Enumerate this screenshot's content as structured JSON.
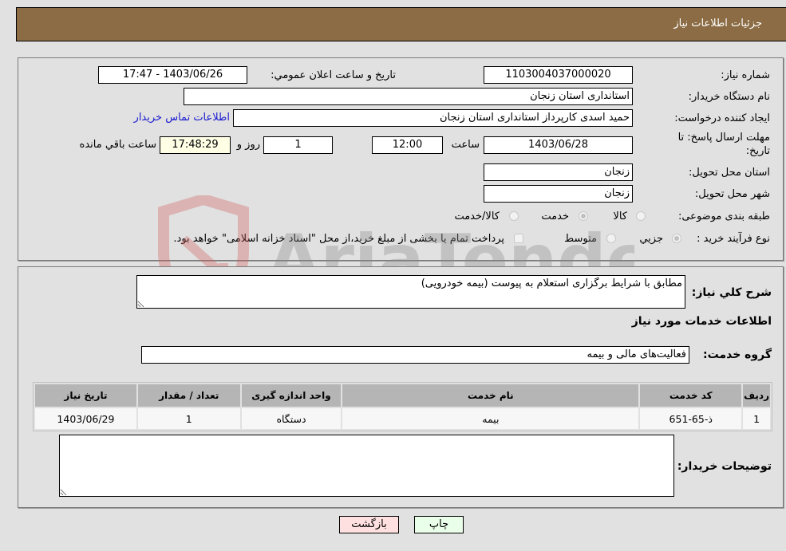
{
  "header": {
    "title": "جزئیات اطلاعات نیاز"
  },
  "details": {
    "need_number": {
      "label": "شماره نیاز:",
      "value": "1103004037000020"
    },
    "announce_datetime": {
      "label": "تاریخ و ساعت اعلان عمومي:",
      "value": "1403/06/26 - 17:47"
    },
    "buyer_org": {
      "label": "نام دستگاه خريدار:",
      "value": "استانداری استان زنجان"
    },
    "requester": {
      "label": "ايجاد کننده درخواست:",
      "value": "حمید اسدی کارپرداز استانداری استان زنجان"
    },
    "buyer_contact_link": "اطلاعات تماس خريدار",
    "deadline": {
      "label_line1": "مهلت ارسال پاسخ: تا",
      "label_line2": "تاریخ:",
      "date": "1403/06/28",
      "time_label": "ساعت",
      "time": "12:00",
      "days": "1",
      "days_label": "روز و",
      "remaining_time": "17:48:29",
      "remaining_label": "ساعت باقي مانده"
    },
    "delivery_province": {
      "label": "استان محل تحويل:",
      "value": "زنجان"
    },
    "delivery_city": {
      "label": "شهر محل تحويل:",
      "value": "زنجان"
    },
    "category": {
      "label": "طبقه بندی موضوعی:",
      "options": [
        "کالا",
        "خدمت",
        "کالا/خدمت"
      ],
      "selected": "خدمت"
    },
    "purchase_type": {
      "label": "نوع فرآیند خرید :",
      "options": [
        "جزيي",
        "متوسط"
      ],
      "selected": "جزيي",
      "treasury_note": "پرداخت تمام یا بخشی از مبلغ خرید،از محل \"اسناد خزانه اسلامی\" خواهد بود.",
      "treasury_checked": false
    }
  },
  "description": {
    "label": "شرح کلي نياز:",
    "value": "مطابق با شرایط برگزاری استعلام به پیوست (بیمه خودرویی)"
  },
  "services": {
    "section_title": "اطلاعات خدمات مورد نياز",
    "group_label": "گروه خدمت:",
    "group_value": "فعالیت‌های مالی و بیمه",
    "table": {
      "columns": [
        "رديف",
        "کد خدمت",
        "نام خدمت",
        "واحد اندازه گيری",
        "تعداد / مقدار",
        "تاريخ نياز"
      ],
      "rows": [
        [
          "1",
          "ذ-65-651",
          "بیمه",
          "دستگاه",
          "1",
          "1403/06/29"
        ]
      ]
    }
  },
  "buyer_notes": {
    "label": "توضيحات خريدار:",
    "value": ""
  },
  "buttons": {
    "print": "چاپ",
    "back": "بازگشت"
  },
  "watermark": {
    "text": "AriaTender.neT"
  },
  "colors": {
    "header_bg": "#8b6c44",
    "print_bg": "#eaffea",
    "back_bg": "#ffe0e0",
    "link": "#1a1ad0"
  }
}
